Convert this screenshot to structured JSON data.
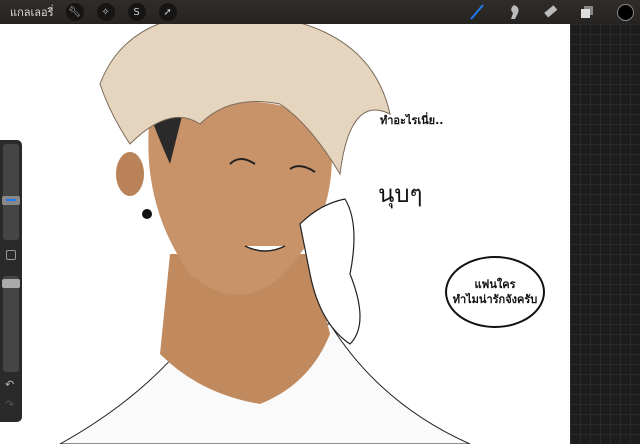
{
  "topbar": {
    "gallery_label": "แกลเลอรี่",
    "left_tools": [
      "wrench-icon",
      "magic-wand-icon",
      "selection-icon",
      "transform-arrow-icon"
    ],
    "right_tools": [
      "brush-icon",
      "smudge-icon",
      "eraser-icon",
      "layers-icon",
      "color-icon"
    ],
    "active_color": "#000000",
    "accent": "#1e7cf0"
  },
  "canvas": {
    "caption_top": "ทำอะไรเนี่ย..",
    "handwritten": "นุบๆ",
    "bubble_line1": "แฟนใคร",
    "bubble_line2": "ทำไมน่ารักจังครับ"
  }
}
